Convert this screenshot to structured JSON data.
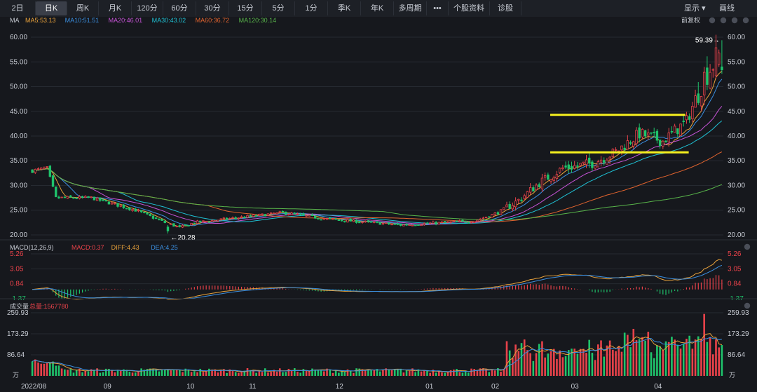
{
  "toolbar": {
    "periods": [
      "2日",
      "日K",
      "周K",
      "月K",
      "120分",
      "60分",
      "30分",
      "15分",
      "5分",
      "1分",
      "季K",
      "年K",
      "多周期"
    ],
    "active": "日K",
    "more": "•••",
    "profile": "个股资料",
    "diagnose": "诊股",
    "display": "显示",
    "draw": "画线"
  },
  "colors": {
    "up": "#e8424a",
    "down": "#1fc36b",
    "ma5": "#e9a23b",
    "ma10": "#3b8fe0",
    "ma20": "#c653d6",
    "ma30": "#1fc0d3",
    "ma60": "#e0632e",
    "ma120": "#58b44a",
    "mark": "#f5f01e"
  },
  "chart_data": [
    {
      "type": "candlestick",
      "title": "MA",
      "legend": [
        "MA5:53.13",
        "MA10:51.51",
        "MA20:46.01",
        "MA30:43.02",
        "MA60:36.72",
        "MA120:30.14"
      ],
      "adjust_label": "前复权",
      "y_ticks": [
        "60.00",
        "55.00",
        "50.00",
        "45.00",
        "40.00",
        "35.00",
        "30.00",
        "25.00",
        "20.00"
      ],
      "ylim": [
        19,
        61
      ],
      "x_labels": [
        "2022/08",
        "09",
        "10",
        "11",
        "12",
        "01",
        "02",
        "03",
        "04"
      ],
      "low_label": "20.28",
      "high_label": "59.39",
      "anchors": [
        [
          0,
          33
        ],
        [
          5,
          33.5
        ],
        [
          8,
          27.5
        ],
        [
          20,
          27.5
        ],
        [
          35,
          25
        ],
        [
          45,
          22.5
        ],
        [
          50,
          21.5
        ],
        [
          55,
          22.5
        ],
        [
          70,
          23.5
        ],
        [
          85,
          24.5
        ],
        [
          100,
          23.2
        ],
        [
          115,
          22.5
        ],
        [
          125,
          22.0
        ],
        [
          140,
          22.5
        ],
        [
          150,
          22.8
        ],
        [
          158,
          24.5
        ],
        [
          165,
          27.0
        ],
        [
          172,
          30.5
        ],
        [
          180,
          33.5
        ],
        [
          190,
          34.5
        ],
        [
          198,
          36.8
        ],
        [
          206,
          40.5
        ],
        [
          214,
          39.0
        ],
        [
          222,
          43.0
        ],
        [
          228,
          52.0
        ],
        [
          232,
          55.5
        ],
        [
          234,
          54.0
        ]
      ],
      "n": 235,
      "ma_final": [
        53.13,
        51.51,
        46.01,
        43.02,
        36.72,
        30.14
      ],
      "hlines": [
        [
          44.3,
          0.75,
          0.945
        ],
        [
          36.7,
          0.75,
          0.95
        ]
      ]
    },
    {
      "type": "macd",
      "title": "MACD(12,26,9)",
      "legend": [
        "MACD:0.37",
        "DIFF:4.43",
        "DEA:4.25"
      ],
      "y_ticks": [
        "5.26",
        "3.05",
        "0.84",
        "-1.37"
      ],
      "ylim": [
        -1.37,
        5.26
      ]
    },
    {
      "type": "volume",
      "title": "成交量",
      "legend": [
        "总量:1567780"
      ],
      "y_ticks": [
        "259.93",
        "173.29",
        "86.64"
      ],
      "unit": "万",
      "ylim": [
        0,
        259.93
      ]
    }
  ]
}
